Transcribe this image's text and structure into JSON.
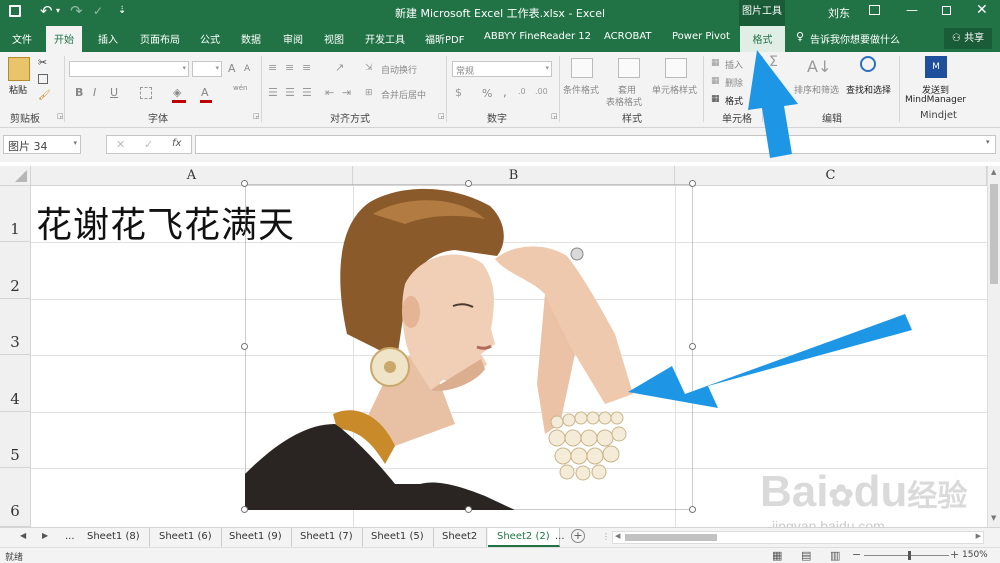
{
  "titlebar": {
    "title": "新建 Microsoft Excel 工作表.xlsx  -  Excel",
    "context_tools": "图片工具",
    "user": "刘东"
  },
  "tabs": [
    "文件",
    "开始",
    "插入",
    "页面布局",
    "公式",
    "数据",
    "审阅",
    "视图",
    "开发工具",
    "福昕PDF",
    "ABBYY FineReader 12",
    "ACROBAT",
    "Power Pivot",
    "格式"
  ],
  "tell_me": "告诉我你想要做什么",
  "share": "共享",
  "ribbon": {
    "clipboard": {
      "paste": "粘贴",
      "label": "剪贴板"
    },
    "font": {
      "label": "字体",
      "bold": "B",
      "italic": "I",
      "underline": "U",
      "grow": "A",
      "shrink": "A",
      "wen": "wén"
    },
    "alignment": {
      "wrap": "自动换行",
      "merge": "合并后居中",
      "label": "对齐方式"
    },
    "number": {
      "format": "常规",
      "percent": "%",
      "comma": ",",
      "label": "数字"
    },
    "styles": {
      "conditional": "条件格式",
      "table": "套用\n表格格式",
      "cell_styles": "单元格样式",
      "label": "样式"
    },
    "cells": {
      "insert": "插入",
      "delete": "删除",
      "format": "格式",
      "label": "单元格"
    },
    "editing": {
      "sort": "排序和筛选",
      "find": "查找和选择",
      "label": "编辑"
    },
    "mindjet": {
      "send": "发送到",
      "target": "MindManager",
      "label": "Mindjet"
    }
  },
  "formula_bar": {
    "name_box": "图片 34",
    "fx": "fx",
    "value": ""
  },
  "columns": [
    "A",
    "B",
    "C"
  ],
  "rows": [
    "1",
    "2",
    "3",
    "4",
    "5",
    "6"
  ],
  "cell_a1": "花谢花飞花满天",
  "sheets": [
    "...",
    "Sheet1 (8)",
    "Sheet1 (6)",
    "Sheet1 (9)",
    "Sheet1 (7)",
    "Sheet1 (5)",
    "Sheet2",
    "Sheet2 (2)",
    "..."
  ],
  "active_sheet": "Sheet2 (2)",
  "status": {
    "mode": "就绪",
    "zoom": "150%"
  },
  "watermark": {
    "brand": "Bai",
    "brand2": "du",
    "cn": "经验",
    "url": "jingyan.baidu.com"
  },
  "colors": {
    "excel_green": "#217346",
    "arrow_blue": "#1e96e6",
    "ribbon_bg": "#f3f3f3"
  }
}
